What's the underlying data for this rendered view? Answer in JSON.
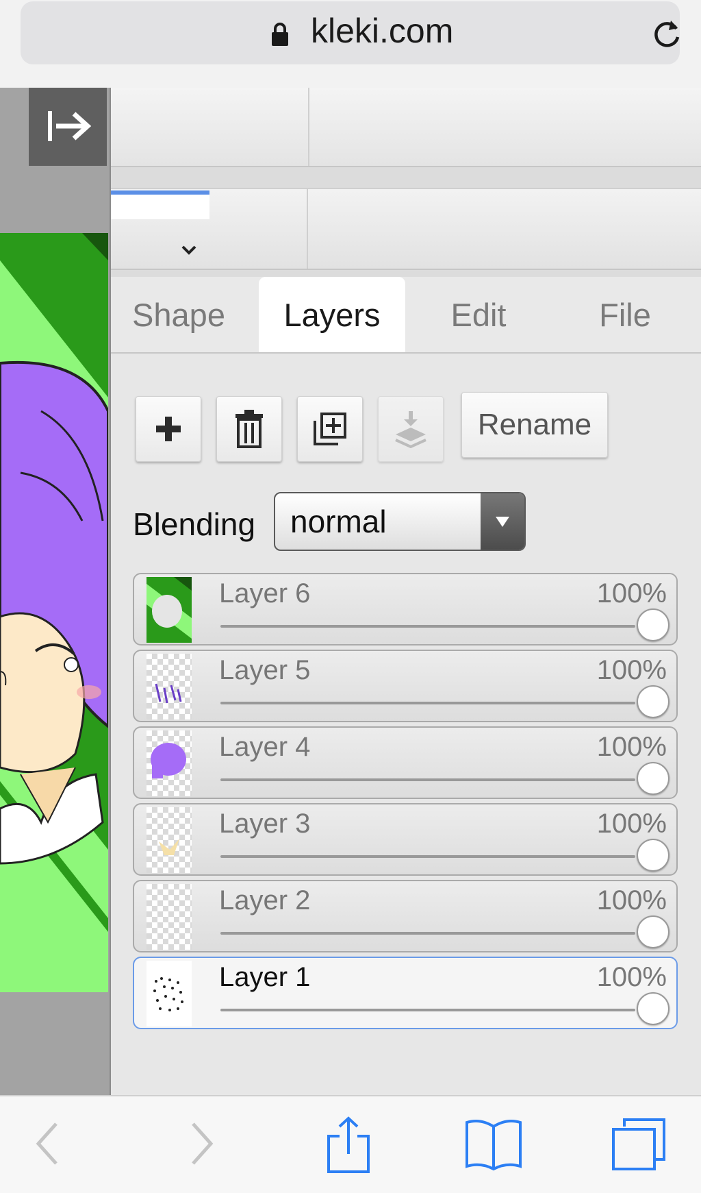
{
  "browser": {
    "url": "kleki.com",
    "icons": [
      "lock-icon",
      "reload-icon",
      "back-icon",
      "forward-icon",
      "share-icon",
      "bookmarks-icon",
      "tabs-icon"
    ]
  },
  "colors": {
    "accent": "#5b8fe6",
    "ios_blue": "#2c7ff4",
    "green_dark": "#2a9a1a",
    "green_light": "#8ef77a",
    "hair_purple": "#a56cf7"
  },
  "tabs": [
    {
      "label": "Shape",
      "active": false
    },
    {
      "label": "Layers",
      "active": true
    },
    {
      "label": "Edit",
      "active": false
    },
    {
      "label": "File",
      "active": false
    }
  ],
  "layer_toolbar": {
    "rename_label": "Rename",
    "icons": [
      "plus-icon",
      "trash-icon",
      "duplicate-icon",
      "merge-down-icon"
    ]
  },
  "blending": {
    "label": "Blending",
    "value": "normal"
  },
  "layers": [
    {
      "name": "Layer 6",
      "opacity_label": "100%",
      "opacity": 1.0,
      "selected": false
    },
    {
      "name": "Layer 5",
      "opacity_label": "100%",
      "opacity": 1.0,
      "selected": false
    },
    {
      "name": "Layer 4",
      "opacity_label": "100%",
      "opacity": 1.0,
      "selected": false
    },
    {
      "name": "Layer 3",
      "opacity_label": "100%",
      "opacity": 1.0,
      "selected": false
    },
    {
      "name": "Layer 2",
      "opacity_label": "100%",
      "opacity": 1.0,
      "selected": false
    },
    {
      "name": "Layer 1",
      "opacity_label": "100%",
      "opacity": 1.0,
      "selected": true
    }
  ]
}
